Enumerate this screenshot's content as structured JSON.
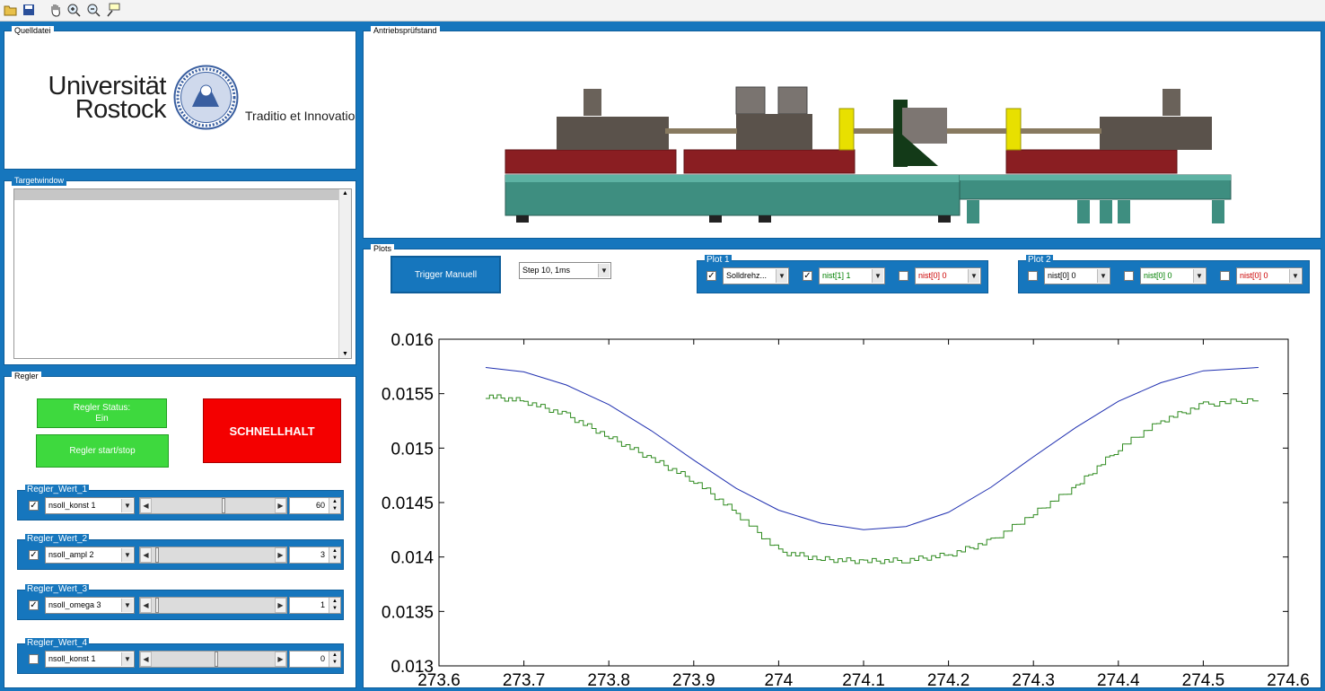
{
  "toolbar": {
    "icons": [
      "open-folder-icon",
      "save-icon",
      "pan-hand-icon",
      "zoom-in-icon",
      "zoom-out-icon",
      "data-cursor-icon"
    ]
  },
  "quelldatei": {
    "title": "Quelldatei",
    "logo_line1": "Universität",
    "logo_line2": "Rostock",
    "motto": "Traditio et Innovatio"
  },
  "stand": {
    "title": "Antriebsprüfstand"
  },
  "target": {
    "title": "Targetwindow"
  },
  "regler": {
    "title": "Regler",
    "status_line1": "Regler Status:",
    "status_line2": "Ein",
    "startstop": "Regler start/stop",
    "stop": "SCHNELLHALT",
    "rows": [
      {
        "title": "Regler_Wert_1",
        "checked": true,
        "select": "nsoll_konst 1",
        "value": "60",
        "level": 0.58
      },
      {
        "title": "Regler_Wert_2",
        "checked": true,
        "select": "nsoll_ampl 2",
        "value": "3",
        "level": 0.02
      },
      {
        "title": "Regler_Wert_3",
        "checked": true,
        "select": "nsoll_omega 3",
        "value": "1",
        "level": 0.02
      },
      {
        "title": "Regler_Wert_4",
        "checked": false,
        "select": "nsoll_konst 1",
        "value": "0",
        "level": 0.52
      }
    ]
  },
  "plots": {
    "title": "Plots",
    "trigger": "Trigger Manuell",
    "step": "Step 10,   1ms",
    "plot1": {
      "title": "Plot 1",
      "items": [
        {
          "checked": true,
          "select": "Solldrehz...",
          "color": "#000000"
        },
        {
          "checked": true,
          "select": "nist[1] 1",
          "color": "#008000"
        },
        {
          "checked": false,
          "select": "nist[0] 0",
          "color": "#cc0000"
        }
      ]
    },
    "plot2": {
      "title": "Plot 2",
      "items": [
        {
          "checked": false,
          "select": "nist[0] 0",
          "color": "#000000"
        },
        {
          "checked": false,
          "select": "nist[0] 0",
          "color": "#008000"
        },
        {
          "checked": false,
          "select": "nist[0] 0",
          "color": "#cc0000"
        }
      ]
    }
  },
  "chart_data": {
    "type": "line",
    "title": "",
    "xlabel": "",
    "ylabel": "",
    "xlim": [
      273.6,
      274.6
    ],
    "ylim": [
      0.013,
      0.016
    ],
    "xticks": [
      "273.6",
      "273.7",
      "273.8",
      "273.9",
      "274",
      "274.1",
      "274.2",
      "274.3",
      "274.4",
      "274.5",
      "274.6"
    ],
    "yticks": [
      "0.016",
      "0.0155",
      "0.015",
      "0.0145",
      "0.014",
      "0.0135",
      "0.013"
    ],
    "grid": false,
    "series": [
      {
        "color": "#1f2fb0",
        "x": [
          273.655,
          273.7,
          273.75,
          273.8,
          273.85,
          273.9,
          273.95,
          274.0,
          274.05,
          274.1,
          274.15,
          274.2,
          274.25,
          274.3,
          274.35,
          274.4,
          274.45,
          274.5,
          274.565
        ],
        "y": [
          0.01574,
          0.0157,
          0.01558,
          0.0154,
          0.01516,
          0.01489,
          0.01463,
          0.01443,
          0.01431,
          0.01425,
          0.01428,
          0.01441,
          0.01464,
          0.01492,
          0.01519,
          0.01543,
          0.0156,
          0.01571,
          0.01574
        ]
      },
      {
        "color": "#2e8a1e",
        "x": [
          273.655,
          273.7,
          273.75,
          273.8,
          273.85,
          273.9,
          273.95,
          274.0,
          274.05,
          274.1,
          274.15,
          274.2,
          274.25,
          274.3,
          274.35,
          274.4,
          274.45,
          274.5,
          274.565
        ],
        "y": [
          0.01548,
          0.01543,
          0.0153,
          0.0151,
          0.0149,
          0.0147,
          0.0144,
          0.01405,
          0.01398,
          0.01396,
          0.01397,
          0.01402,
          0.01415,
          0.0144,
          0.01465,
          0.015,
          0.01525,
          0.0154,
          0.01545
        ]
      }
    ]
  }
}
